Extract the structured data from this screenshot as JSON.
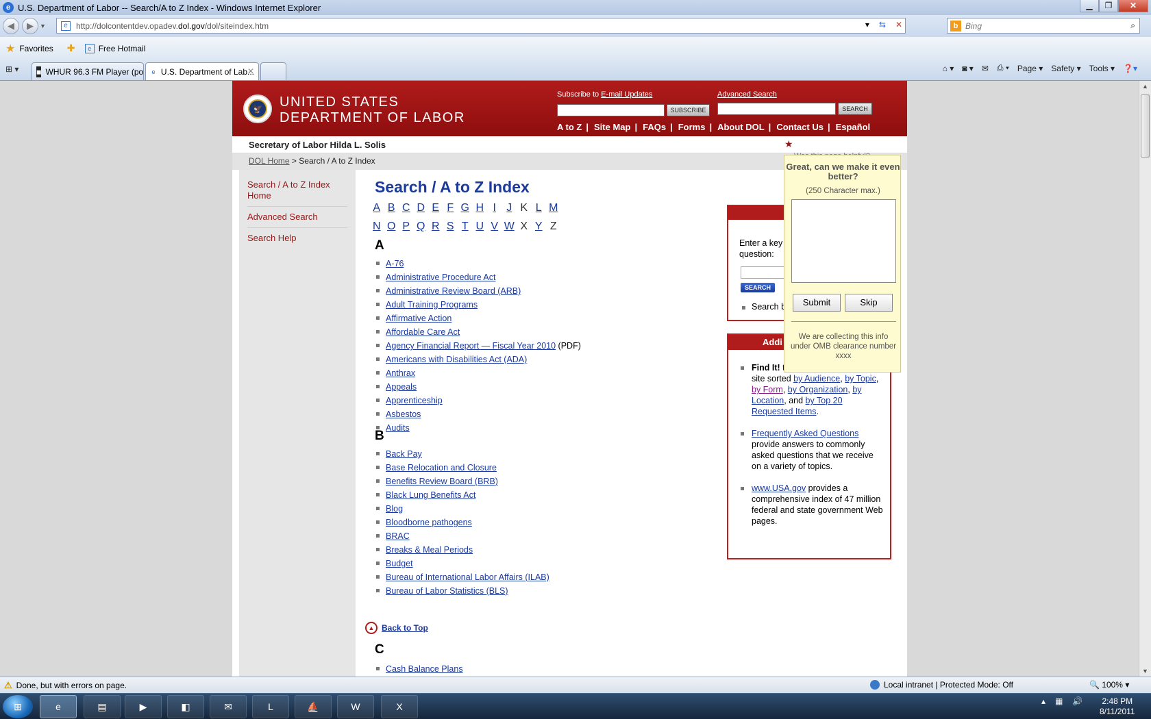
{
  "window": {
    "title": "U.S. Department of Labor -- Search/A to Z Index - Windows Internet Explorer",
    "minimize": "▁",
    "maximize": "❐",
    "close": "✕"
  },
  "address_bar": {
    "url_prefix": "http://dolcontentdev.opadev.",
    "url_domain": "dol.gov",
    "url_suffix": "/dol/siteindex.htm",
    "search_placeholder": "Bing"
  },
  "favorites_bar": {
    "favorites_label": "Favorites",
    "hotmail_label": "Free Hotmail"
  },
  "tabs": [
    {
      "label": "WHUR 96.3 FM Player (po...",
      "active": false
    },
    {
      "label": "U.S. Department of Lab...",
      "active": true
    }
  ],
  "command_bar": {
    "page": "Page ▾",
    "safety": "Safety ▾",
    "tools": "Tools ▾"
  },
  "site": {
    "org_line1": "UNITED STATES",
    "org_line2": "DEPARTMENT OF LABOR",
    "subscribe_prefix": "Subscribe to ",
    "subscribe_link": "E-mail Updates",
    "subscribe_button": "SUBSCRIBE",
    "advanced_search_link": "Advanced Search",
    "search_button": "SEARCH",
    "topnav": [
      "A to Z",
      "Site Map",
      "FAQs",
      "Forms",
      "About DOL",
      "Contact Us",
      "Español"
    ],
    "secretary": "Secretary of Labor Hilda L. Solis",
    "breadcrumb_home": "DOL Home",
    "breadcrumb_sep": " > ",
    "breadcrumb_current": "Search / A to Z Index",
    "helpful_question": "Was this page helpful?"
  },
  "leftnav": [
    "Search / A to Z Index Home",
    "Advanced Search",
    "Search Help"
  ],
  "main": {
    "title": "Search / A to Z Index",
    "letters_row1": [
      {
        "l": "A",
        "link": true
      },
      {
        "l": "B",
        "link": true
      },
      {
        "l": "C",
        "link": true
      },
      {
        "l": "D",
        "link": true
      },
      {
        "l": "E",
        "link": true
      },
      {
        "l": "F",
        "link": true
      },
      {
        "l": "G",
        "link": true
      },
      {
        "l": "H",
        "link": true
      },
      {
        "l": "I",
        "link": true
      },
      {
        "l": "J",
        "link": true
      },
      {
        "l": "K",
        "link": false
      },
      {
        "l": "L",
        "link": true
      },
      {
        "l": "M",
        "link": true
      }
    ],
    "letters_row2": [
      {
        "l": "N",
        "link": true
      },
      {
        "l": "O",
        "link": true
      },
      {
        "l": "P",
        "link": true
      },
      {
        "l": "Q",
        "link": true
      },
      {
        "l": "R",
        "link": true
      },
      {
        "l": "S",
        "link": true
      },
      {
        "l": "T",
        "link": true
      },
      {
        "l": "U",
        "link": true
      },
      {
        "l": "V",
        "link": true
      },
      {
        "l": "W",
        "link": true
      },
      {
        "l": "X",
        "link": false
      },
      {
        "l": "Y",
        "link": true
      },
      {
        "l": "Z",
        "link": false
      }
    ],
    "section_a": "A",
    "items_a": [
      {
        "text": "A-76"
      },
      {
        "text": "Administrative Procedure Act"
      },
      {
        "text": "Administrative Review Board (ARB)"
      },
      {
        "text": "Adult Training Programs"
      },
      {
        "text": "Affirmative Action"
      },
      {
        "text": "Affordable Care Act"
      },
      {
        "text": "Agency Financial Report — Fiscal Year 2010",
        "suffix": " (PDF)"
      },
      {
        "text": "Americans with Disabilities Act (ADA)"
      },
      {
        "text": "Anthrax"
      },
      {
        "text": "Appeals"
      },
      {
        "text": "Apprenticeship"
      },
      {
        "text": "Asbestos"
      },
      {
        "text": "Audits"
      }
    ],
    "section_b": "B",
    "items_b": [
      {
        "text": "Back Pay"
      },
      {
        "text": "Base Relocation and Closure"
      },
      {
        "text": "Benefits Review Board (BRB)"
      },
      {
        "text": "Black Lung Benefits Act"
      },
      {
        "text": "Blog"
      },
      {
        "text": "Bloodborne pathogens"
      },
      {
        "text": "BRAC"
      },
      {
        "text": "Breaks & Meal Periods"
      },
      {
        "text": "Budget"
      },
      {
        "text": "Bureau of International Labor Affairs (ILAB)"
      },
      {
        "text": "Bureau of Labor Statistics (BLS)"
      }
    ],
    "back_to_top": "Back to Top",
    "section_c": "C",
    "items_c": [
      {
        "text": "Cash Balance Plans"
      }
    ]
  },
  "search_box": {
    "prompt_line1": "Enter a key",
    "prompt_line2": "question:",
    "button": "SEARCH",
    "bullet": "Search b"
  },
  "additional_box": {
    "header": "Addi",
    "find_it_bold": "Find It!",
    "find_it_text": " to resources on our Web site sorted ",
    "by_audience": "by Audience",
    "by_topic": "by Topic",
    "by_form": "by Form",
    "by_org": "by Organization",
    "by_location": "by Location",
    "by_top20": "by Top 20 Requested Items",
    "and_text": ", and ",
    "comma": ", ",
    "period": ".",
    "faq_link": "Frequently Asked Questions",
    "faq_text": " provide answers to commonly asked questions that we receive on a variety of topics.",
    "usa_link": "www.USA.gov",
    "usa_text": " provides a comprehensive index of 47 million federal and state government Web pages."
  },
  "feedback": {
    "heading": "Great, can we make it even better?",
    "limit": "(250 Character max.)",
    "submit": "Submit",
    "skip": "Skip",
    "note": "We are collecting this info under OMB clearance number xxxx"
  },
  "status_bar": {
    "text": "Done, but with errors on page.",
    "zone": "Local intranet | Protected Mode: Off",
    "zoom": "100%"
  },
  "taskbar": {
    "time": "2:48 PM",
    "date": "8/11/2011"
  }
}
